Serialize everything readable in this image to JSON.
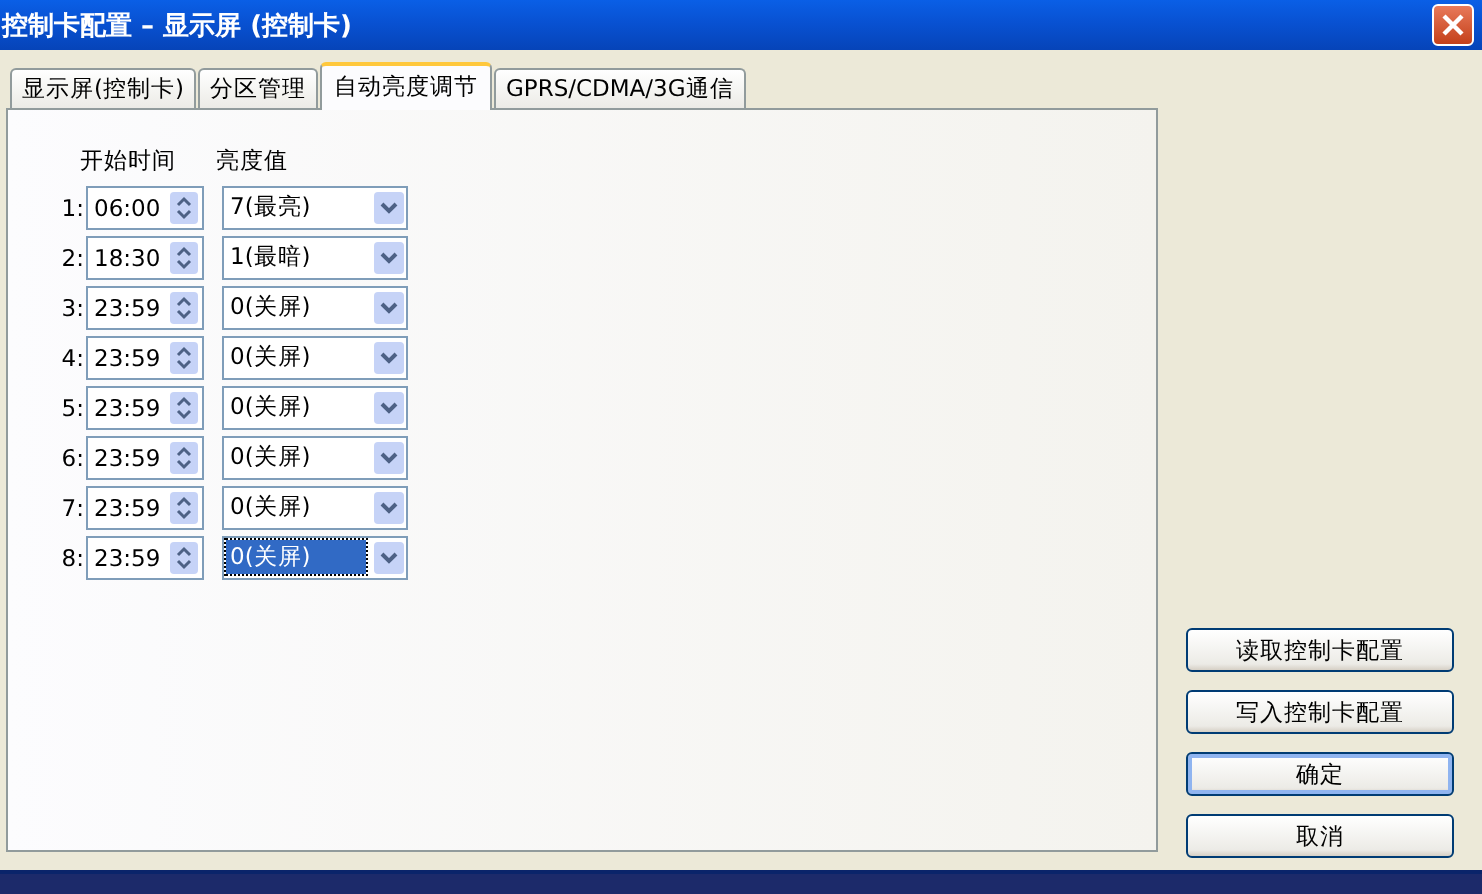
{
  "window": {
    "title": "控制卡配置 – 显示屏 (控制卡)"
  },
  "tabs": [
    {
      "label": "显示屏(控制卡)",
      "selected": false
    },
    {
      "label": "分区管理",
      "selected": false
    },
    {
      "label": "自动亮度调节",
      "selected": true
    },
    {
      "label": "GPRS/CDMA/3G通信",
      "selected": false
    }
  ],
  "columns": [
    "开始时间",
    "亮度值"
  ],
  "rows": [
    {
      "index": "1:",
      "time": "06:00",
      "brightness": "7(最亮)",
      "focused": false
    },
    {
      "index": "2:",
      "time": "18:30",
      "brightness": "1(最暗)",
      "focused": false
    },
    {
      "index": "3:",
      "time": "23:59",
      "brightness": "0(关屏)",
      "focused": false
    },
    {
      "index": "4:",
      "time": "23:59",
      "brightness": "0(关屏)",
      "focused": false
    },
    {
      "index": "5:",
      "time": "23:59",
      "brightness": "0(关屏)",
      "focused": false
    },
    {
      "index": "6:",
      "time": "23:59",
      "brightness": "0(关屏)",
      "focused": false
    },
    {
      "index": "7:",
      "time": "23:59",
      "brightness": "0(关屏)",
      "focused": false
    },
    {
      "index": "8:",
      "time": "23:59",
      "brightness": "0(关屏)",
      "focused": true
    }
  ],
  "buttons": [
    {
      "label": "读取控制卡配置",
      "default": false
    },
    {
      "label": "写入控制卡配置",
      "default": false
    },
    {
      "label": "确定",
      "default": true
    },
    {
      "label": "取消",
      "default": false
    }
  ]
}
